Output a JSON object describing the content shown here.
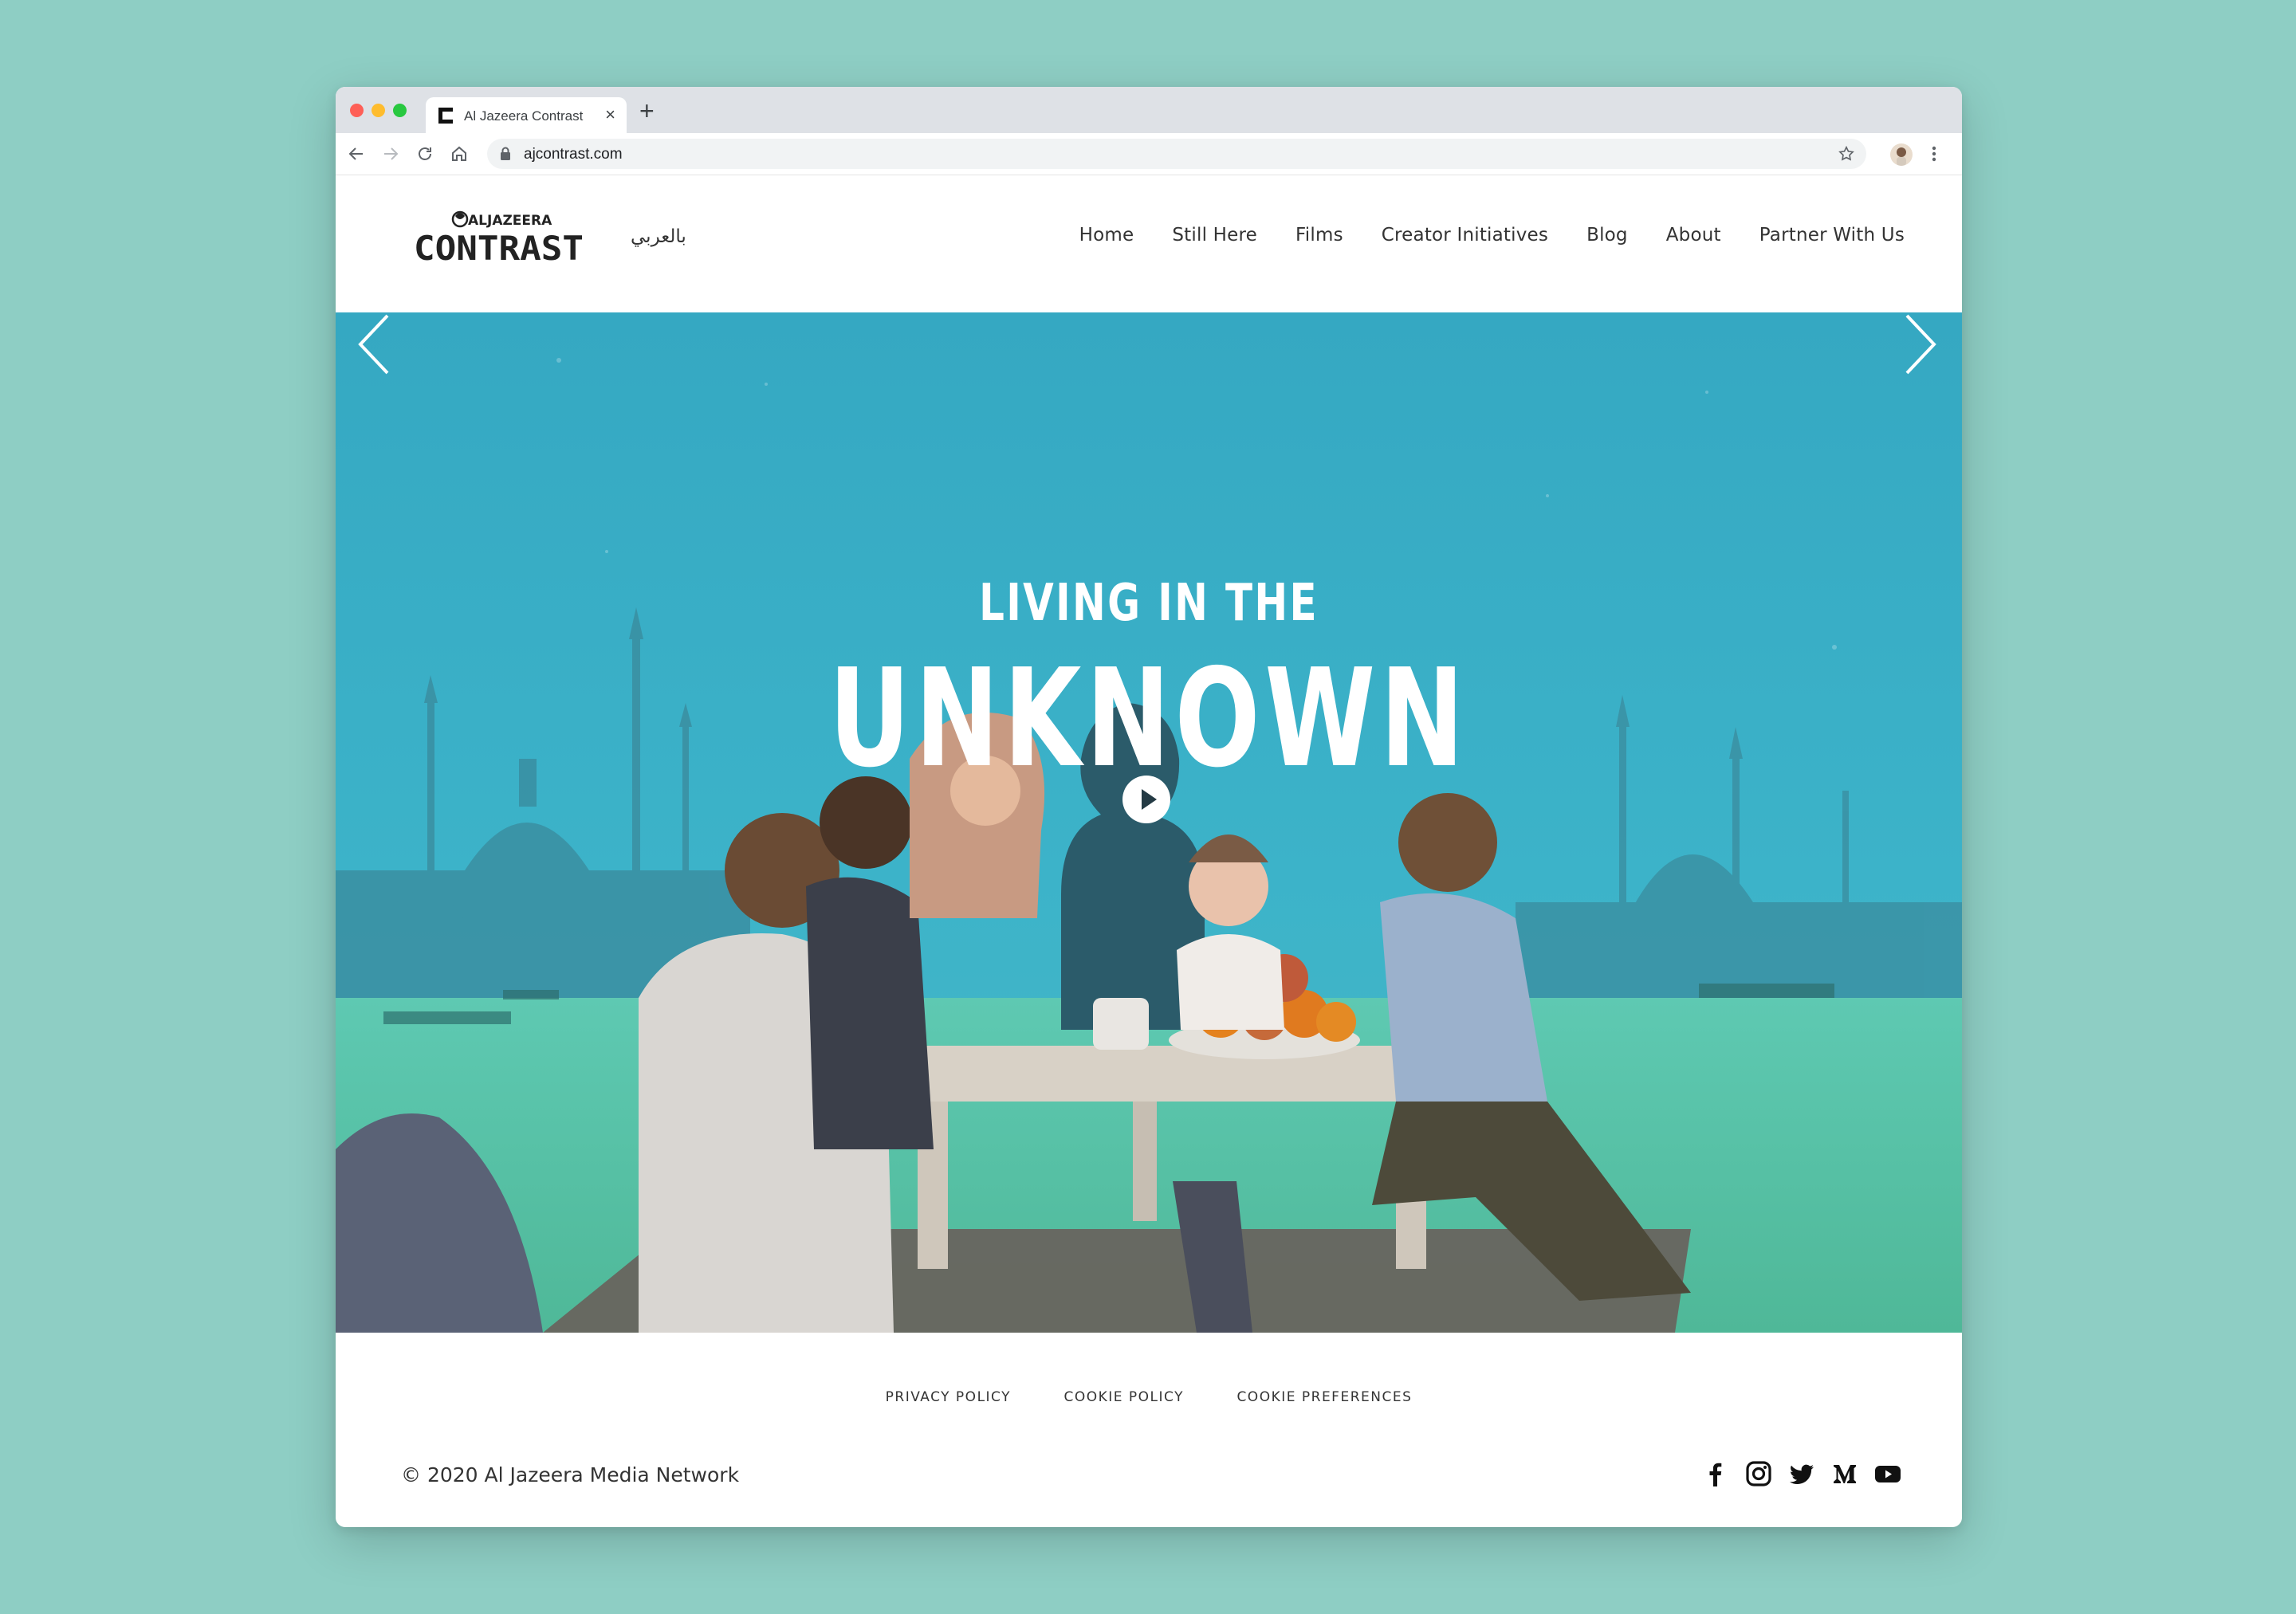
{
  "browser": {
    "tab_title": "Al Jazeera Contrast",
    "tab_close": "×",
    "new_tab": "+",
    "url": "ajcontrast.com"
  },
  "header": {
    "logo_top": "ALJAZEERA",
    "logo_main": "CONTRAST",
    "arabic_link": "بالعربي",
    "nav": [
      "Home",
      "Still Here",
      "Films",
      "Creator Initiatives",
      "Blog",
      "About",
      "Partner With Us"
    ]
  },
  "hero": {
    "subtitle": "LIVING IN THE",
    "title": "UNKNOWN"
  },
  "footer": {
    "links": [
      "PRIVACY POLICY",
      "COOKIE POLICY",
      "COOKIE PREFERENCES"
    ],
    "copyright": "© 2020 Al Jazeera Media Network",
    "social_icons": [
      "facebook-icon",
      "instagram-icon",
      "twitter-icon",
      "medium-icon",
      "youtube-icon"
    ]
  },
  "colors": {
    "page_background": "#8ecec4",
    "hero_sky": "#3fb2c8",
    "hero_water": "#5fc6a8"
  }
}
